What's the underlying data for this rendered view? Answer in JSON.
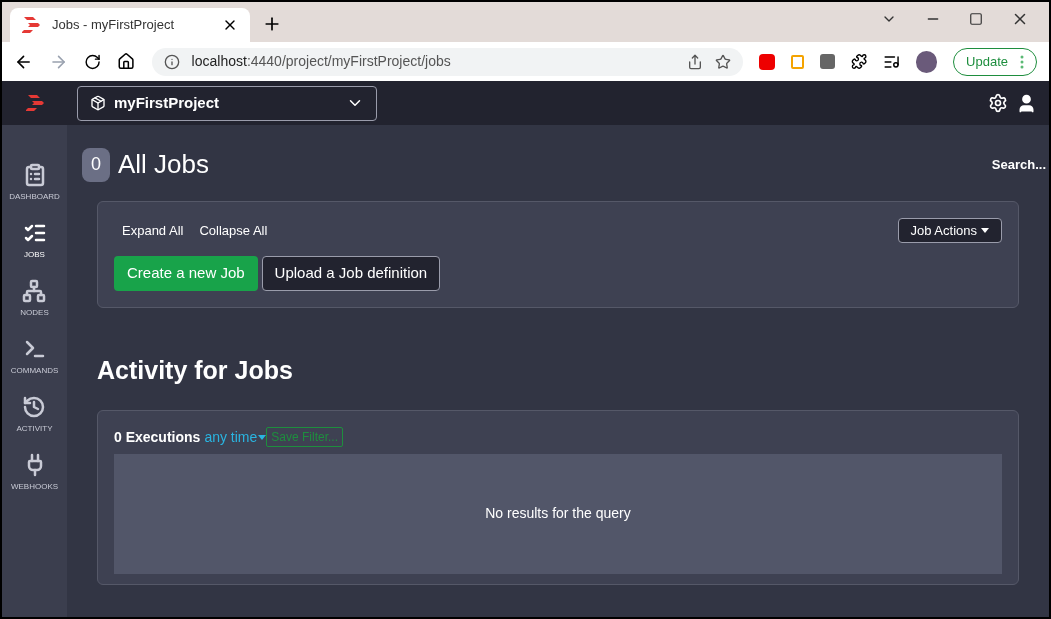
{
  "browser": {
    "tab_title": "Jobs - myFirstProject",
    "url_host": "localhost",
    "url_rest": ":4440/project/myFirstProject/jobs",
    "update_button": "Update"
  },
  "header": {
    "project": "myFirstProject"
  },
  "sidebar": {
    "items": [
      {
        "kind": "dashboard",
        "label": "DASHBOARD",
        "selected": false
      },
      {
        "kind": "jobs",
        "label": "JOBS",
        "selected": true
      },
      {
        "kind": "nodes",
        "label": "NODES",
        "selected": false
      },
      {
        "kind": "commands",
        "label": "COMMANDS",
        "selected": false
      },
      {
        "kind": "activity",
        "label": "ACTIVITY",
        "selected": false
      },
      {
        "kind": "webhooks",
        "label": "WEBHOOKS",
        "selected": false
      }
    ]
  },
  "page": {
    "count": "0",
    "title": "All Jobs",
    "search": "Search...",
    "expand_all": "Expand All",
    "collapse_all": "Collapse All",
    "job_actions": "Job Actions",
    "create_button": "Create a new Job",
    "upload_button": "Upload a Job definition"
  },
  "activity": {
    "title": "Activity for Jobs",
    "executions": "0 Executions",
    "time_filter": "any time",
    "save_filter": "Save Filter...",
    "empty_message": "No results for the query"
  }
}
